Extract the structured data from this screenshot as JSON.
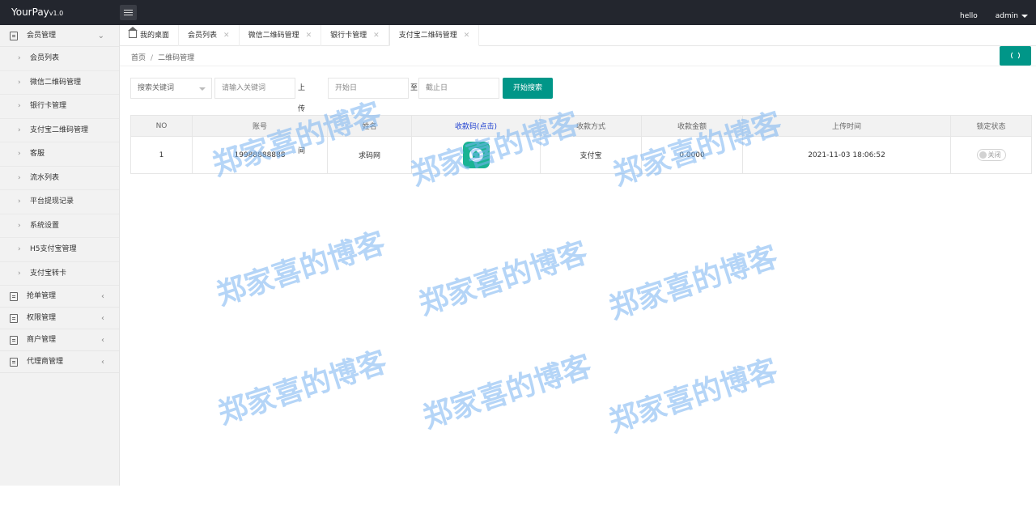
{
  "header": {
    "logo": "YourPay",
    "version": "v1.0",
    "greeting": "hello",
    "user": "admin"
  },
  "sidebar": {
    "groups": [
      {
        "label": "会员管理",
        "expanded": true,
        "items": [
          "会员列表",
          "微信二维码管理",
          "银行卡管理",
          "支付宝二维码管理",
          "客服",
          "流水列表",
          "平台提现记录",
          "系统设置",
          "H5支付宝管理",
          "支付宝转卡"
        ]
      },
      {
        "label": "抢单管理"
      },
      {
        "label": "权限管理"
      },
      {
        "label": "商户管理"
      },
      {
        "label": "代理商管理"
      }
    ]
  },
  "tabs": [
    {
      "label": "我的桌面",
      "closable": false
    },
    {
      "label": "会员列表",
      "closable": true
    },
    {
      "label": "微信二维码管理",
      "closable": true
    },
    {
      "label": "银行卡管理",
      "closable": true
    },
    {
      "label": "支付宝二维码管理",
      "closable": true,
      "active": true
    }
  ],
  "breadcrumb": {
    "home": "首页",
    "separator": "/",
    "current": "二维码管理"
  },
  "search": {
    "select_placeholder": "搜索关键词",
    "keyword_placeholder": "请输入关键词",
    "upload_time_label": "上传时间",
    "start_placeholder": "开始日",
    "to_label": "至",
    "end_placeholder": "截止日",
    "button": "开始搜索"
  },
  "table": {
    "headers": [
      "NO",
      "账号",
      "姓名",
      "收款码(点击)",
      "收款方式",
      "收款金额",
      "上传时间",
      "锁定状态"
    ],
    "rows": [
      {
        "no": "1",
        "account": "19988888888",
        "name": "求码网",
        "method": "支付宝",
        "amount": "0.0000",
        "time": "2021-11-03 18:06:52",
        "lock": "关闭"
      }
    ]
  },
  "watermark": "郑家喜的博客",
  "colors": {
    "primary": "#009688",
    "topbar": "#23262e",
    "watermark": "#78b2f0",
    "link": "#1e3fd0"
  }
}
